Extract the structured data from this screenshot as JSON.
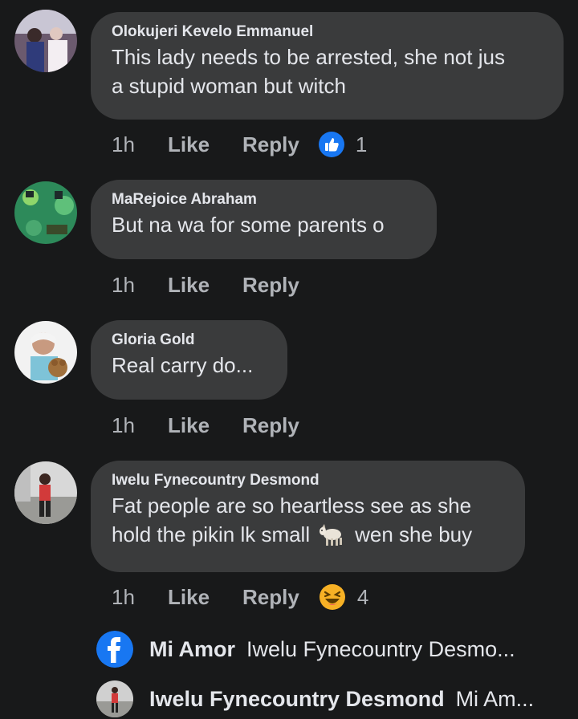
{
  "comments": [
    {
      "author": "Olokujeri Kevelo Emmanuel",
      "text_line1": "This lady needs to be arrested, she not jus",
      "text_line2": "a stupid woman but witch",
      "time": "1h",
      "like": "Like",
      "reply": "Reply",
      "reaction": {
        "icon": "like-reaction-icon",
        "count": "1"
      }
    },
    {
      "author": "MaRejoice Abraham",
      "text_line1": "But na wa for some parents o",
      "time": "1h",
      "like": "Like",
      "reply": "Reply"
    },
    {
      "author": "Gloria Gold",
      "text_line1": "Real carry do...",
      "time": "1h",
      "like": "Like",
      "reply": "Reply"
    },
    {
      "author": "Iwelu Fynecountry Desmond",
      "text_line1": "Fat people are so heartless see as she",
      "text_line2_a": "hold the pikin lk small",
      "text_line2_emoji": "goat-emoji",
      "text_line2_b": "wen she buy",
      "time": "1h",
      "like": "Like",
      "reply": "Reply",
      "reaction": {
        "icon": "haha-reaction-icon",
        "count": "4"
      }
    }
  ],
  "replies": [
    {
      "author": "Mi Amor",
      "preview": "Iwelu Fynecountry Desmo..."
    },
    {
      "author": "Iwelu Fynecountry Desmond",
      "preview": "Mi Am..."
    }
  ],
  "colors": {
    "background": "#18191a",
    "bubble": "#3a3b3c",
    "text": "#e4e6eb",
    "meta": "#b0b3b8",
    "like_blue": "#1877f2",
    "haha_yellow": "#f7b125"
  }
}
